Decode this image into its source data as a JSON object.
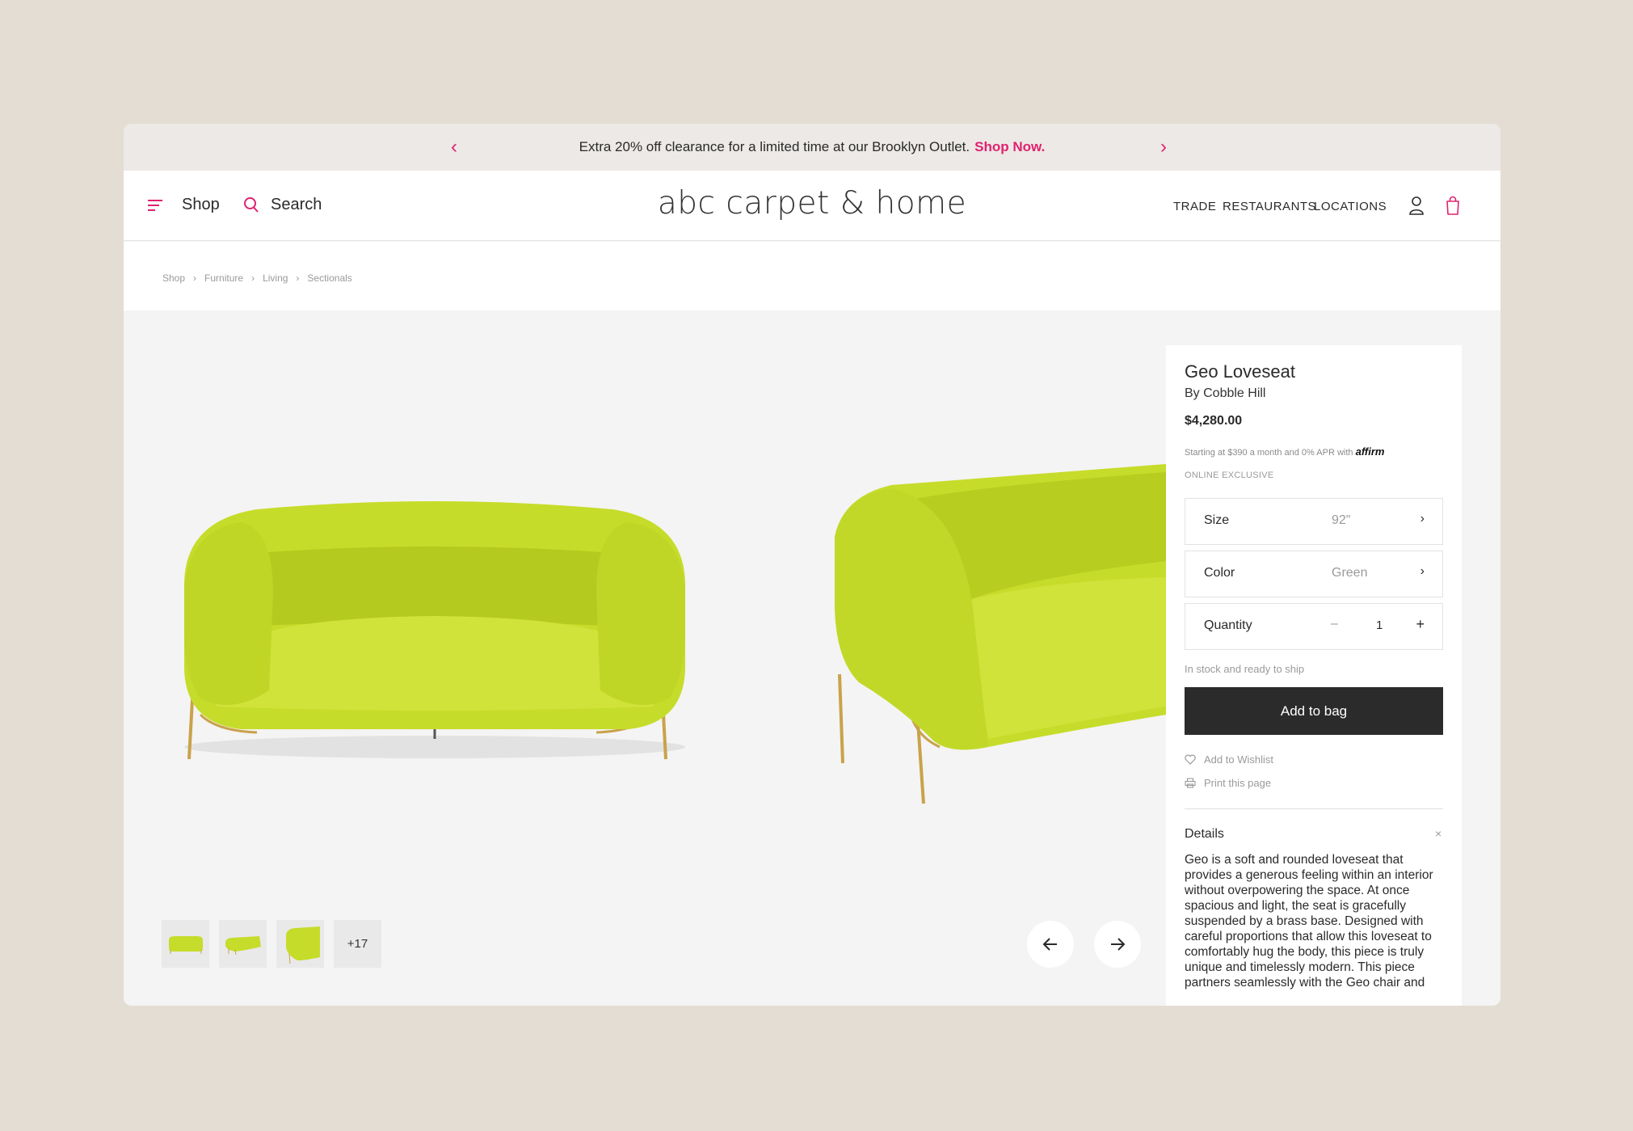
{
  "promo": {
    "message": "Extra 20% off clearance for a limited time at our Brooklyn Outlet.",
    "cta": "Shop Now.",
    "prev_icon": "chevron-left-icon",
    "next_icon": "chevron-right-icon"
  },
  "header": {
    "menu_label": "Shop",
    "search_label": "Search",
    "logo": "abc carpet & home",
    "nav": [
      "TRADE",
      "RESTAURANTS",
      "LOCATIONS"
    ],
    "account_icon": "user-icon",
    "cart_icon": "shopping-bag-icon"
  },
  "breadcrumb": [
    "Shop",
    "Furniture",
    "Living",
    "Sectionals"
  ],
  "gallery": {
    "thumbnails": [
      "loveseat-front",
      "loveseat-angle",
      "loveseat-side"
    ],
    "more_count": "+17"
  },
  "product": {
    "title": "Geo Loveseat",
    "brand": "By Cobble Hill",
    "price": "$4,280.00",
    "financing": "Starting at $390 a month and 0% APR with",
    "financing_provider": "affirm",
    "badge": "ONLINE EXCLUSIVE",
    "options": {
      "size_label": "Size",
      "size_value": "92\"",
      "color_label": "Color",
      "color_value": "Green",
      "quantity_label": "Quantity",
      "quantity_minus": "–",
      "quantity_value": "1",
      "quantity_plus": "+"
    },
    "stock_status": "In stock and ready to ship",
    "add_to_bag": "Add to bag",
    "wishlist": "Add to Wishlist",
    "print": "Print this page",
    "details_heading": "Details",
    "details_close": "×",
    "description": "Geo is a soft and rounded loveseat that provides a generous feeling within an interior without overpowering the space. At once spacious and light, the seat is gracefully suspended by a brass base. Designed with careful proportions that allow this loveseat to comfortably hug the body, this piece is truly unique and timelessly modern. This piece partners seamlessly with the Geo chair and"
  },
  "colors": {
    "accent": "#e0226e",
    "sofa": "#c6dc2a",
    "brass": "#c9a24a",
    "button": "#2b2b2b",
    "backdrop": "#e4ddd3"
  }
}
